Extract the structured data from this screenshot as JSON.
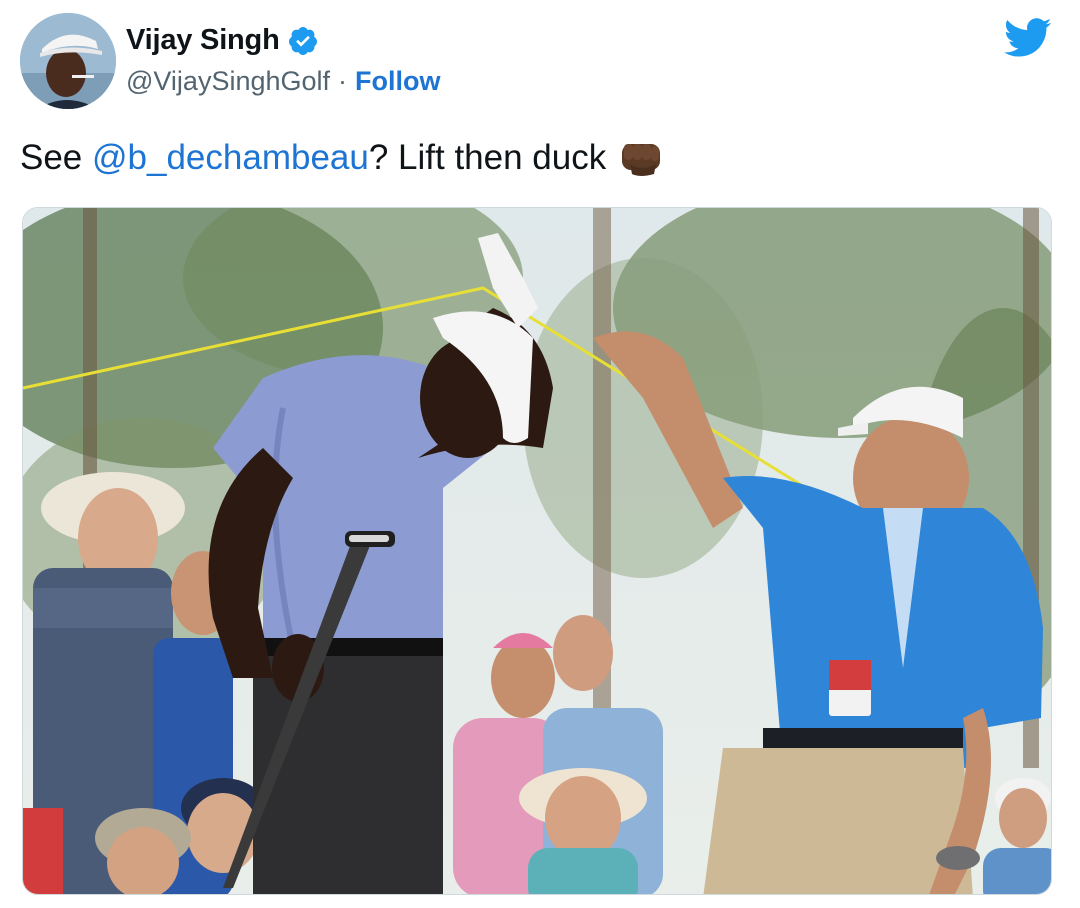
{
  "author": {
    "name": "Vijay Singh",
    "handle": "@VijaySinghGolf",
    "separator": "·",
    "follow_label": "Follow",
    "verified": true
  },
  "tweet": {
    "text_before": "See ",
    "mention": "@b_dechambeau",
    "text_after": "? Lift then duck",
    "emoji": "oncoming-fist-dark-skin-emoji"
  },
  "media": {
    "type": "photo",
    "description_icon": "golf-photo"
  },
  "colors": {
    "link": "#1d74d2",
    "twitter_blue": "#1d9bf0",
    "text": "#0f1419",
    "secondary": "#536471"
  },
  "icons": {
    "brand": "twitter-bird-icon",
    "verified": "verified-badge-icon"
  }
}
